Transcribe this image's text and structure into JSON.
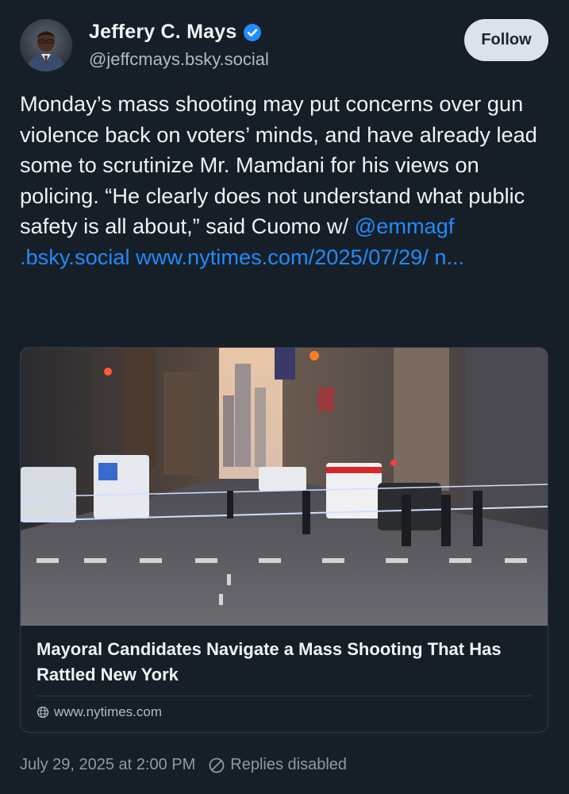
{
  "author": {
    "display_name": "Jeffery C. Mays",
    "handle": "@jeffcmays.bsky.social",
    "verified": true,
    "avatar_icon": "avatar-photo"
  },
  "follow_button": {
    "label": "Follow"
  },
  "post": {
    "text_segments": {
      "t1": "Monday’s mass shooting may put concerns over gun violence back on voters’ minds, and have already lead some to scrutinize Mr. Mamdani for his views on policing. “He clearly does not understand what public safety is all about,” said Cuomo w/ ",
      "mention": "@emmagf .bsky.social",
      "space": " ",
      "url": "www.nytimes.com/2025/07/29/ n..."
    }
  },
  "link_card": {
    "image_alt": "street-scene-photo",
    "title": "Mayoral Candidates Navigate a Mass Shooting That Has Rattled New York",
    "domain": "www.nytimes.com",
    "domain_icon": "globe-icon"
  },
  "footer": {
    "timestamp": "July 29, 2025 at 2:00 PM",
    "replies_label": "Replies disabled",
    "replies_icon": "disabled-circle-icon"
  },
  "colors": {
    "background": "#161e27",
    "link": "#208bfe",
    "verified": "#208bfe",
    "follow_button_bg": "#dce2ea",
    "muted_text": "#8d9aa8"
  }
}
